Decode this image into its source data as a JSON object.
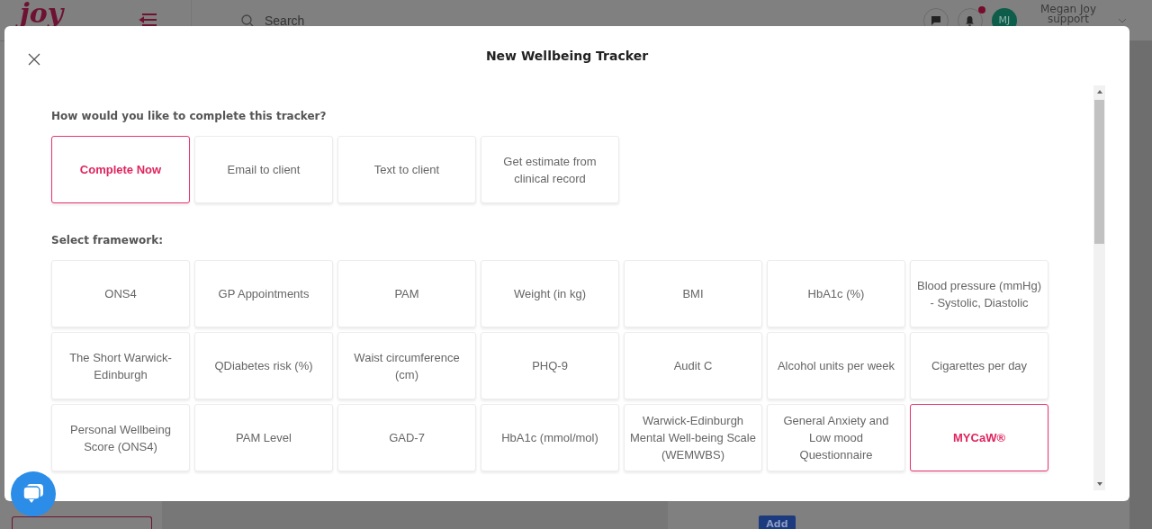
{
  "background_app": {
    "logo": "joy",
    "search": {
      "placeholder": "Search"
    },
    "notifications": {
      "unread": true
    },
    "user": {
      "initials": "MJ",
      "name": "Megan Joy",
      "role": "support"
    },
    "add_button": "Add"
  },
  "modal": {
    "title": "New Wellbeing Tracker",
    "method_prompt": "How would you like to complete this tracker?",
    "methods": [
      {
        "label": "Complete Now",
        "selected": true
      },
      {
        "label": "Email to client",
        "selected": false
      },
      {
        "label": "Text to client",
        "selected": false
      },
      {
        "label": "Get estimate from clinical record",
        "selected": false
      }
    ],
    "framework_prompt": "Select framework:",
    "frameworks": [
      {
        "label": "ONS4",
        "selected": false
      },
      {
        "label": "GP Appointments",
        "selected": false
      },
      {
        "label": "PAM",
        "selected": false
      },
      {
        "label": "Weight (in kg)",
        "selected": false
      },
      {
        "label": "BMI",
        "selected": false
      },
      {
        "label": "HbA1c (%)",
        "selected": false
      },
      {
        "label": "Blood pressure (mmHg) - Systolic, Diastolic",
        "selected": false
      },
      {
        "label": "The Short Warwick-Edinburgh",
        "selected": false
      },
      {
        "label": "QDiabetes risk (%)",
        "selected": false
      },
      {
        "label": "Waist circumference (cm)",
        "selected": false
      },
      {
        "label": "PHQ-9",
        "selected": false
      },
      {
        "label": "Audit C",
        "selected": false
      },
      {
        "label": "Alcohol units per week",
        "selected": false
      },
      {
        "label": "Cigarettes per day",
        "selected": false
      },
      {
        "label": "Personal Wellbeing Score (ONS4)",
        "selected": false
      },
      {
        "label": "PAM Level",
        "selected": false
      },
      {
        "label": "GAD-7",
        "selected": false
      },
      {
        "label": "HbA1c (mmol/mol)",
        "selected": false
      },
      {
        "label": "Warwick-Edinburgh Mental Well-being Scale (WEMWBS)",
        "selected": false
      },
      {
        "label": "General Anxiety and Low mood Questionnaire",
        "selected": false
      },
      {
        "label": "MYCaW®",
        "selected": true
      }
    ]
  }
}
